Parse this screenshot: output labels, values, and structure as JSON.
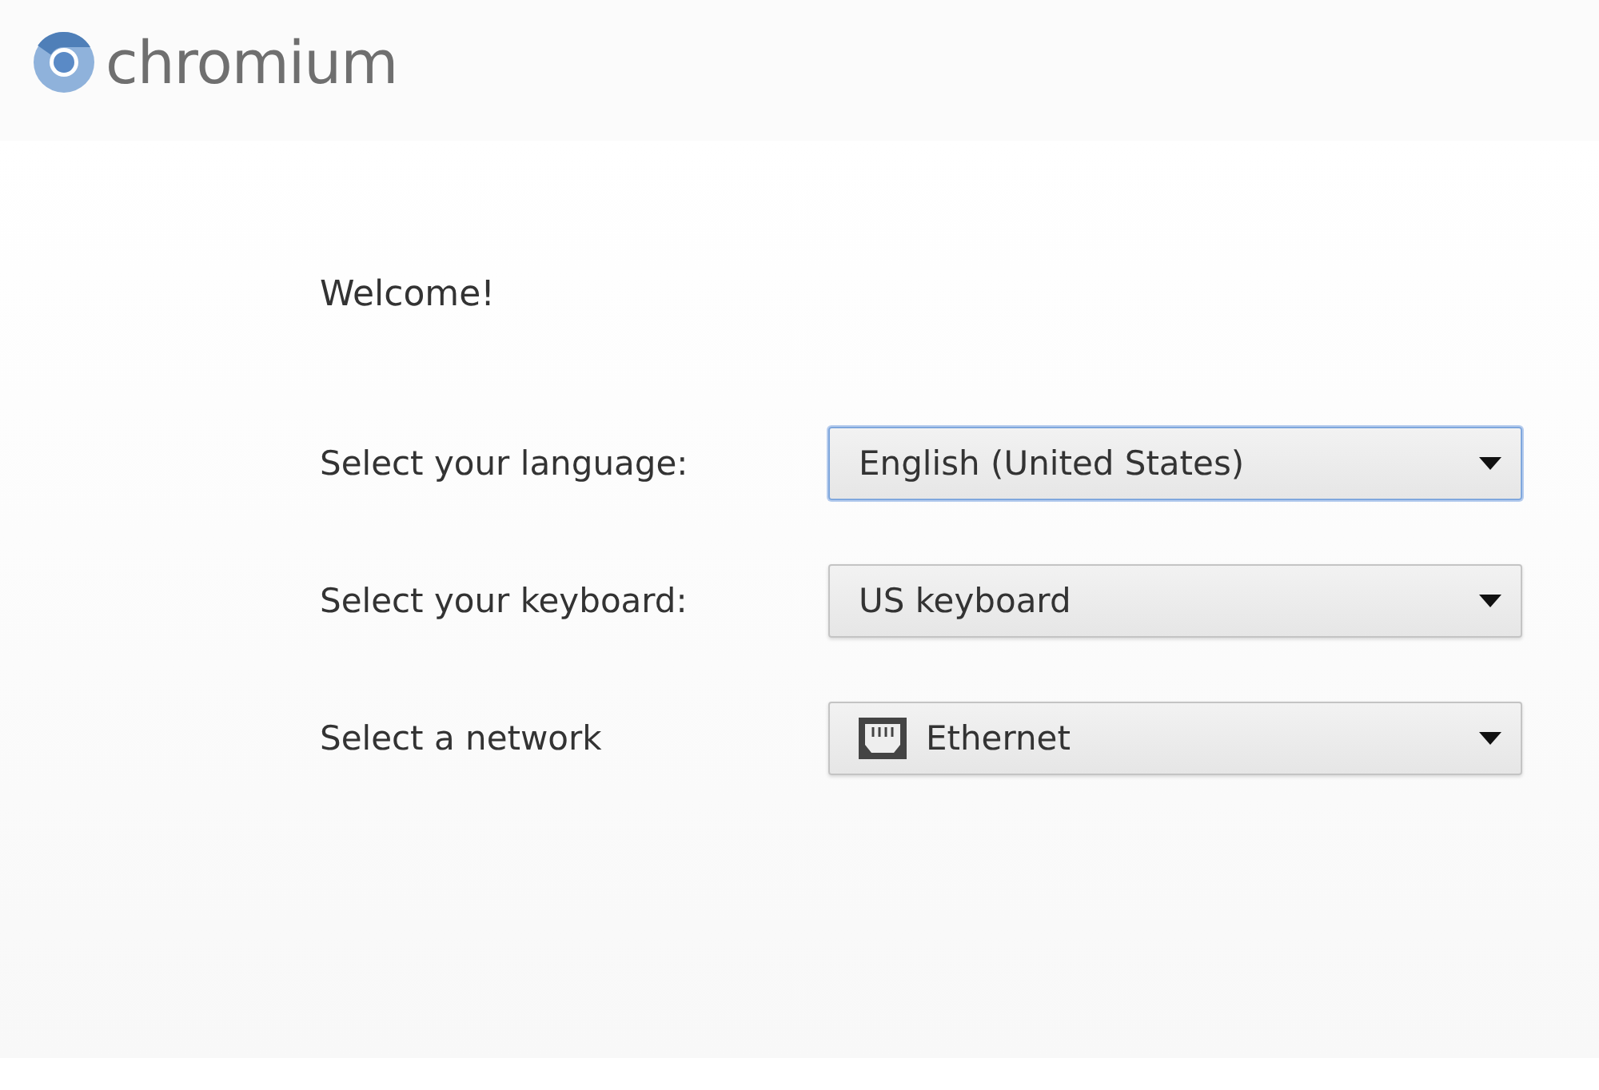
{
  "logo": {
    "text": "chromium"
  },
  "heading": "Welcome!",
  "fields": [
    {
      "label": "Select your language:",
      "value": "English (United States)",
      "focused": true,
      "kind": "plain"
    },
    {
      "label": "Select your keyboard:",
      "value": "US keyboard",
      "focused": false,
      "kind": "plain"
    },
    {
      "label": "Select a network",
      "value": "Ethernet",
      "focused": false,
      "kind": "network"
    }
  ]
}
